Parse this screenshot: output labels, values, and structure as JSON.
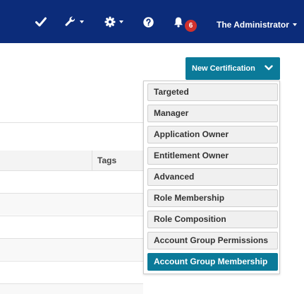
{
  "topbar": {
    "check_icon": "check-icon",
    "wrench_icon": "wrench-icon",
    "gear_icon": "gear-icon",
    "help_icon": "question-circle-icon",
    "bell_icon": "bell-icon",
    "notification_count": "6",
    "user_name": "The Administrator"
  },
  "new_certification": {
    "label": "New Certification"
  },
  "table": {
    "tags_header": "Tags"
  },
  "dropdown": {
    "items": [
      "Targeted",
      "Manager",
      "Application Owner",
      "Entitlement Owner",
      "Advanced",
      "Role Membership",
      "Role Composition",
      "Account Group Permissions",
      "Account Group Membership"
    ]
  },
  "colors": {
    "topbar": "#0c2c7a",
    "accent": "#0b7a99",
    "badge": "#d0312d"
  }
}
